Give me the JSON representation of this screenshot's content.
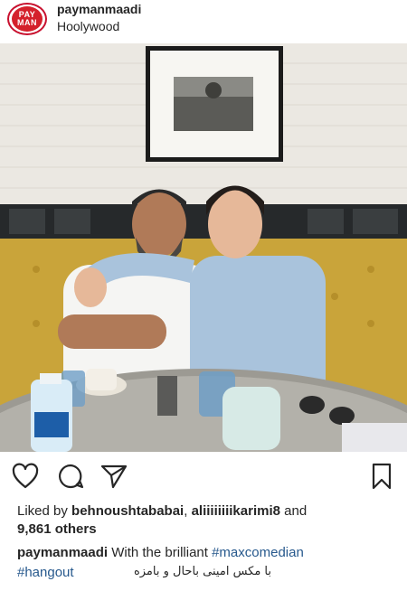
{
  "post": {
    "username": "paymanmaadi",
    "location": "Hoolywood",
    "avatar_text_top": "PAY",
    "avatar_text_bottom": "MAN"
  },
  "photo": {
    "description_colors": {
      "wall": "#ece9e3",
      "sofa": "#c9a43a",
      "table": "#9c9a93"
    }
  },
  "actions": {
    "like_icon": "heart-icon",
    "comment_icon": "comment-icon",
    "share_icon": "paper-plane-icon",
    "save_icon": "bookmark-icon"
  },
  "likes": {
    "prefix": "Liked by ",
    "user1": "behnoushtababai",
    "separator": ", ",
    "user2": "aliiiiiiiikarimi8",
    "and": " and",
    "count": "9,861 others"
  },
  "caption": {
    "username": "paymanmaadi",
    "text": " With the brilliant ",
    "tag1": "#maxcomedian",
    "tag2": "#hangout",
    "persian": "با مکس امینی باحال و بامزه"
  }
}
